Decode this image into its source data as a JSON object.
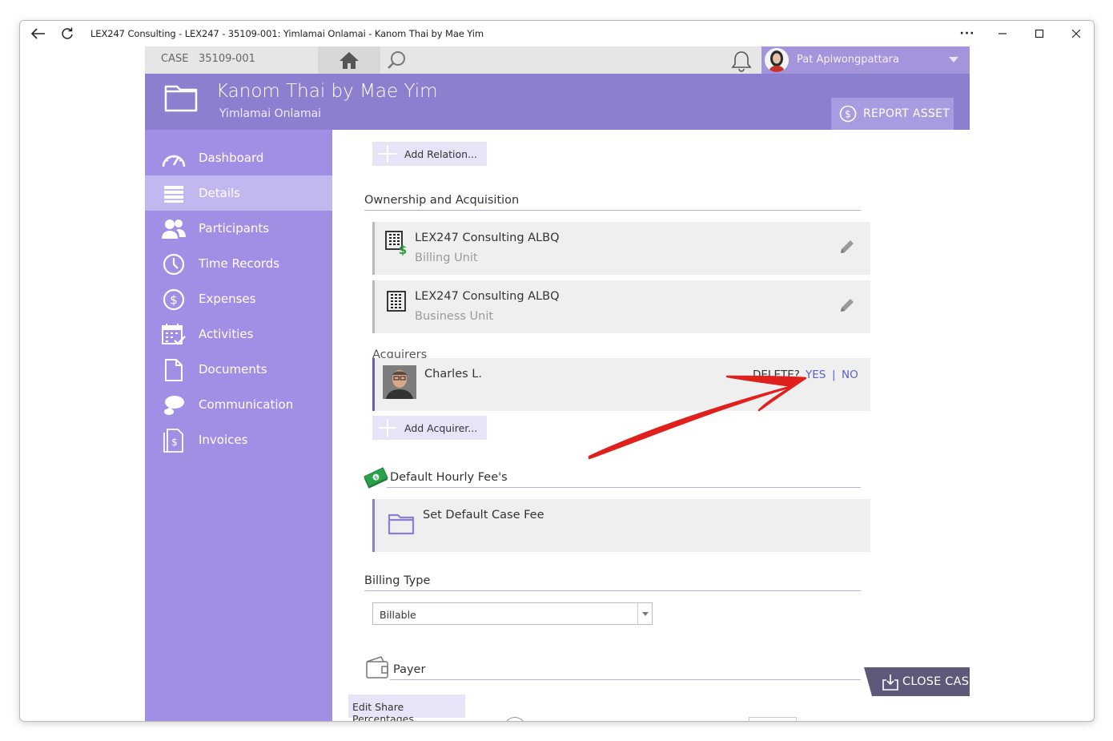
{
  "window": {
    "title": "LEX247 Consulting - LEX247 - 35109-001: Yimlamai Onlamai - Kanom Thai by Mae Yim",
    "more_label": "···"
  },
  "topbar": {
    "case_label": "CASE",
    "case_number": "35109-001",
    "user_name": "Pat Apiwongpattara"
  },
  "header": {
    "title": "Kanom Thai by Mae Yim",
    "subtitle": "Yimlamai Onlamai",
    "report_asset_label": "REPORT ASSET"
  },
  "sidebar": {
    "items": [
      {
        "label": "Dashboard",
        "icon": "gauge-icon"
      },
      {
        "label": "Details",
        "icon": "list-icon",
        "active": true
      },
      {
        "label": "Participants",
        "icon": "people-icon"
      },
      {
        "label": "Time Records",
        "icon": "clock-icon"
      },
      {
        "label": "Expenses",
        "icon": "dollar-circle-icon"
      },
      {
        "label": "Activities",
        "icon": "calendar-check-icon"
      },
      {
        "label": "Documents",
        "icon": "document-icon"
      },
      {
        "label": "Communication",
        "icon": "chat-bubbles-icon"
      },
      {
        "label": "Invoices",
        "icon": "invoice-icon"
      }
    ]
  },
  "main": {
    "add_relation_label": "Add Relation...",
    "ownership_title": "Ownership and Acquisition",
    "billing_unit": {
      "title": "LEX247 Consulting ALBQ",
      "subtitle": "Billing Unit"
    },
    "business_unit": {
      "title": "LEX247 Consulting ALBQ",
      "subtitle": "Business Unit"
    },
    "acquirers_label": "Acquirers",
    "acquirer": {
      "name": "Charles L.",
      "delete_prompt": "DELETE?",
      "yes_label": "YES",
      "separator": "|",
      "no_label": "NO"
    },
    "add_acquirer_label": "Add Acquirer...",
    "default_fee_title": "Default Hourly Fee's",
    "set_default_fee_label": "Set Default Case Fee",
    "billing_type_title": "Billing Type",
    "billing_type_value": "Billable",
    "payer_title": "Payer",
    "edit_share_label": "Edit Share Percentages",
    "close_case_label": "CLOSE CASE"
  },
  "colors": {
    "header": "#8c7fd0",
    "sidebar": "#a18fe6",
    "sidebar_active": "#c2b8f0",
    "link": "#5a5fc8",
    "annotation_arrow": "#e0201c"
  }
}
